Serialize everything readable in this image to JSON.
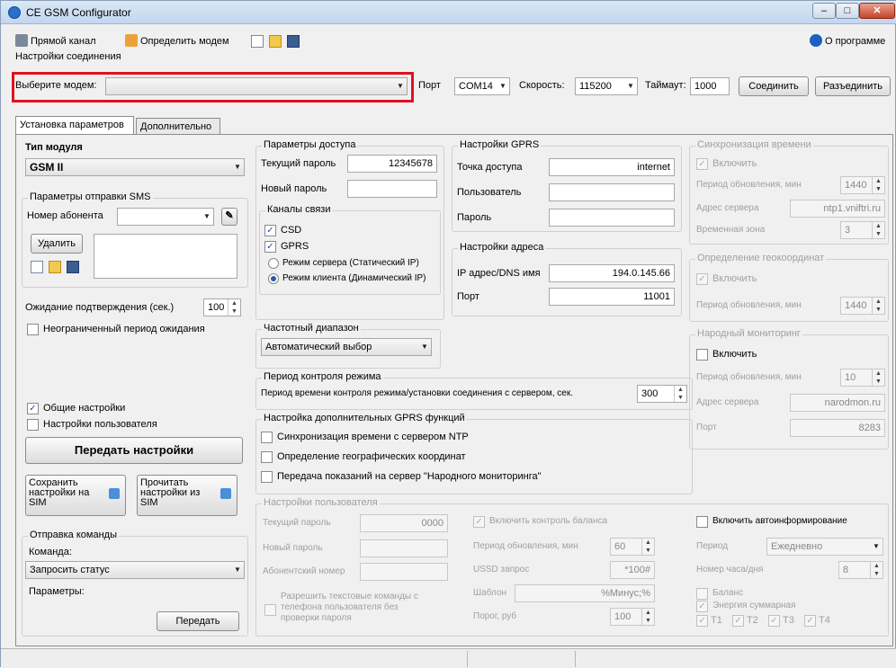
{
  "window": {
    "title": "CE GSM Configurator",
    "minimize": "–",
    "maximize": "□",
    "close": "✕"
  },
  "toolbar": {
    "direct": "Прямой канал",
    "detect": "Определить модем",
    "about": "О программе"
  },
  "connection": {
    "title": "Настройки соединения",
    "modem_label": "Выберите модем:",
    "modem_value": "",
    "port_label": "Порт",
    "port_value": "COM14",
    "speed_label": "Скорость:",
    "speed_value": "115200",
    "timeout_label": "Таймаут:",
    "timeout_value": "1000",
    "connect": "Соединить",
    "disconnect": "Разъединить"
  },
  "tabs": [
    "Установка параметров",
    "Дополнительно"
  ],
  "module": {
    "label": "Тип модуля",
    "value": "GSM II"
  },
  "sms": {
    "title": "Параметры отправки SMS",
    "phone_label": "Номер абонента",
    "delete": "Удалить",
    "wait_label": "Ожидание подтверждения (сек.)",
    "wait_value": "100",
    "unlimited": "Неограниченный период ожидания"
  },
  "settings": {
    "common": "Общие настройки",
    "user": "Настройки пользователя",
    "send": "Передать настройки",
    "save_sim": "Сохранить настройки на SIM",
    "read_sim": "Прочитать настройки из SIM"
  },
  "command": {
    "title": "Отправка команды",
    "cmd_label": "Команда:",
    "cmd_value": "Запросить статус",
    "params_label": "Параметры:",
    "send": "Передать"
  },
  "access": {
    "title": "Параметры доступа",
    "current_label": "Текущий пароль",
    "current_value": "12345678",
    "new_label": "Новый пароль",
    "channels_title": "Каналы связи",
    "csd": "CSD",
    "gprs": "GPRS",
    "server_mode": "Режим сервера (Статический IP)",
    "client_mode": "Режим клиента (Динамический IP)"
  },
  "gprs": {
    "title": "Настройки GPRS",
    "apn_label": "Точка доступа",
    "apn_value": "internet",
    "user_label": "Пользователь",
    "pass_label": "Пароль"
  },
  "address": {
    "title": "Настройки адреса",
    "ip_label": "IP адрес/DNS имя",
    "ip_value": "194.0.145.66",
    "port_label": "Порт",
    "port_value": "11001"
  },
  "freq": {
    "title": "Частотный диапазон",
    "value": "Автоматический выбор"
  },
  "mode_ctrl": {
    "title": "Период контроля режима",
    "label": "Период времени контроля режима/установки соединения с сервером, сек.",
    "value": "300"
  },
  "extra": {
    "title": "Настройка дополнительных GPRS функций",
    "ntp": "Синхронизация времени с сервером NTP",
    "geo": "Определение географических координат",
    "narod": "Передача показаний на сервер \"Народного мониторинга\""
  },
  "time_sync": {
    "title": "Синхронизация времени",
    "enable": "Включить",
    "period_label": "Период обновления, мин",
    "period_value": "1440",
    "server_label": "Адрес сервера",
    "server_value": "ntp1.vniftri.ru",
    "zone_label": "Временная зона",
    "zone_value": "3"
  },
  "geo": {
    "title": "Определение геокоординат",
    "enable": "Включить",
    "period_label": "Период обновления, мин",
    "period_value": "1440"
  },
  "narod": {
    "title": "Народный мониторинг",
    "enable": "Включить",
    "period_label": "Период обновления, мин",
    "period_value": "10",
    "server_label": "Адрес сервера",
    "server_value": "narodmon.ru",
    "port_label": "Порт",
    "port_value": "8283"
  },
  "user_settings": {
    "title": "Настройки пользователя",
    "current_label": "Текущий пароль",
    "current_value": "0000",
    "new_label": "Новый пароль",
    "sub_label": "Абонентский номер",
    "allow_text": "Разрешить текстовые команды с телефона пользователя без проверки пароля"
  },
  "balance": {
    "enable": "Включить контроль баланса",
    "period_label": "Период обновления, мин",
    "period_value": "60",
    "ussd_label": "USSD запрос",
    "ussd_value": "*100#",
    "template_label": "Шаблон",
    "template_value": "%Минус;%",
    "threshold_label": "Порог, руб",
    "threshold_value": "100"
  },
  "autoinfo": {
    "enable": "Включить автоинформирование",
    "period_label": "Период",
    "period_value": "Ежедневно",
    "hour_label": "Номер часа/дня",
    "hour_value": "8",
    "balance": "Баланс",
    "energy": "Энергия суммарная",
    "t1": "T1",
    "t2": "T2",
    "t3": "T3",
    "t4": "T4"
  }
}
